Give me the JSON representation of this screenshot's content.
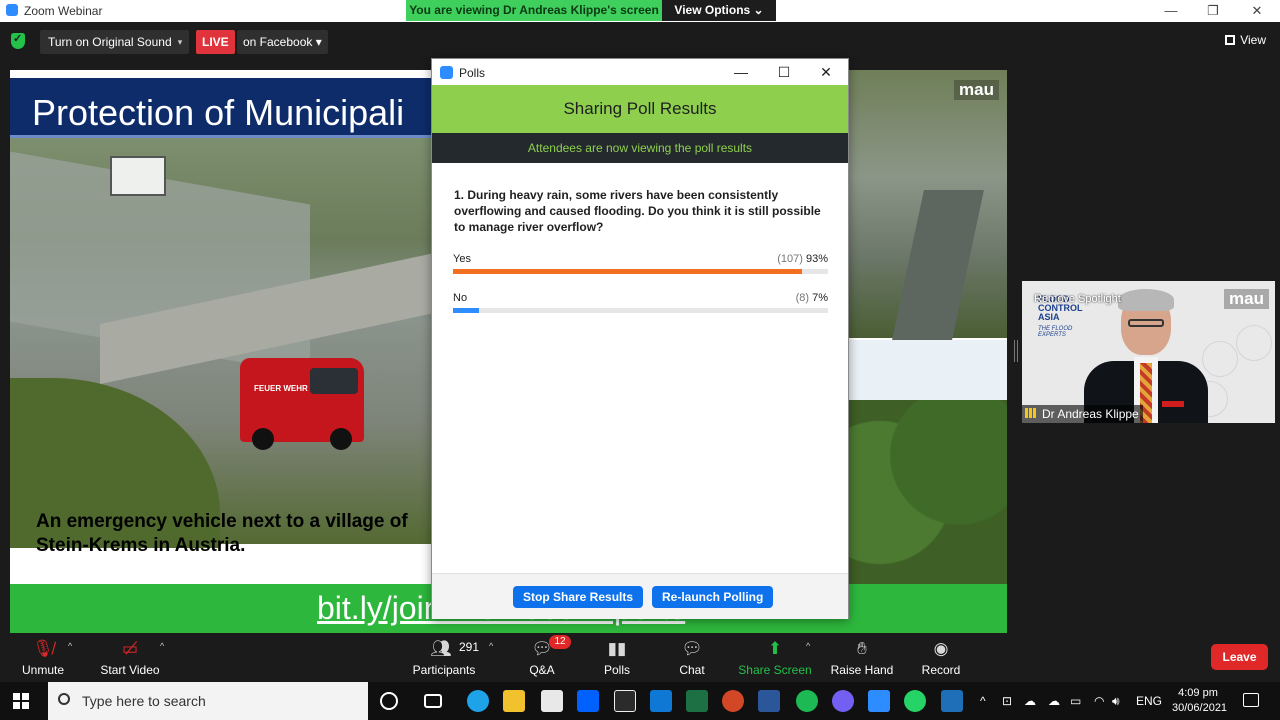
{
  "window": {
    "title": "Zoom Webinar",
    "minimize": "—",
    "maximize": "❐",
    "close": "✕"
  },
  "banner": {
    "viewing_text": "You are viewing Dr Andreas Klippe's screen",
    "view_options": "View Options ⌄"
  },
  "topbar": {
    "sound_button": "Turn on Original Sound",
    "sound_caret": "▾",
    "live_label": "LIVE",
    "live_destination": "on Facebook ▾",
    "view_label": "View"
  },
  "slide": {
    "title": "Protection of Municipali",
    "caption": "An emergency vehicle next to a village of Stein-Krems in Austria.",
    "footer_link": "bit.ly/joinTheFloodExperts",
    "watermark": "mau",
    "van_lettering": "FEUER WEHR"
  },
  "speaker": {
    "name": "Dr Andreas Klippe",
    "spotlight_label": "Remove Spotlight",
    "mau_tag": "mau",
    "logo_line1": "FLOOD CONTROL ASIA",
    "logo_line2": "THE FLOOD EXPERTS"
  },
  "polls": {
    "window_title": "Polls",
    "header": "Sharing Poll Results",
    "subheader": "Attendees are now viewing the poll results",
    "question": "1. During heavy rain, some rivers have been consistently overflowing and caused flooding. Do you think it is still possible to manage river overflow?",
    "options": [
      {
        "label": "Yes",
        "count": "(107)",
        "percent": "93%",
        "fraction": 0.93,
        "color": "#f26f21"
      },
      {
        "label": "No",
        "count": "(8)",
        "percent": "7%",
        "fraction": 0.07,
        "color": "#2d8cff"
      }
    ],
    "stop_button": "Stop Share Results",
    "relaunch_button": "Re-launch Polling"
  },
  "toolbar": {
    "unmute": "Unmute",
    "start_video": "Start Video",
    "participants": "Participants",
    "participants_count": "291",
    "qa": "Q&A",
    "qa_badge": "12",
    "polls": "Polls",
    "chat": "Chat",
    "share_screen": "Share Screen",
    "raise_hand": "Raise Hand",
    "record": "Record",
    "leave": "Leave"
  },
  "taskbar": {
    "search_placeholder": "Type here to search",
    "language": "ENG",
    "time": "4:09 pm",
    "date": "30/06/2021"
  }
}
